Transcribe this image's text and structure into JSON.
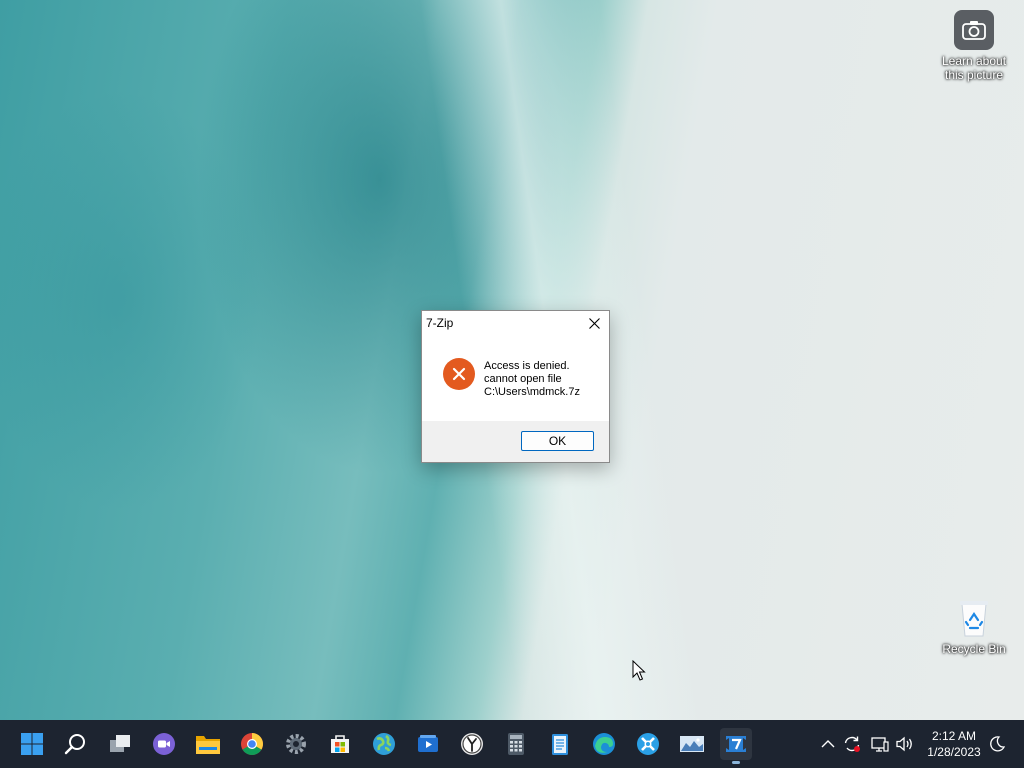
{
  "desktop": {
    "icons": [
      {
        "label": "Learn about this picture",
        "icon": "camera-icon"
      },
      {
        "label": "Recycle Bin",
        "icon": "recycle-bin-icon"
      }
    ]
  },
  "dialog": {
    "title": "7-Zip",
    "message_line1": "Access is denied.",
    "message_line2": "cannot open file",
    "message_line3": "C:\\Users\\mdmck.7z",
    "ok_label": "OK",
    "icon": "error-icon",
    "error_color": "#e35a1f"
  },
  "taskbar": {
    "apps": [
      {
        "name": "Start",
        "icon": "windows-start-icon"
      },
      {
        "name": "Search",
        "icon": "search-icon"
      },
      {
        "name": "Task View",
        "icon": "task-view-icon"
      },
      {
        "name": "Chat",
        "icon": "chat-camera-icon"
      },
      {
        "name": "File Explorer",
        "icon": "folder-icon"
      },
      {
        "name": "Chrome",
        "icon": "chrome-icon"
      },
      {
        "name": "Settings",
        "icon": "gear-icon"
      },
      {
        "name": "Microsoft Store",
        "icon": "store-icon"
      },
      {
        "name": "Maps",
        "icon": "globe-icon"
      },
      {
        "name": "Media Player",
        "icon": "media-icon"
      },
      {
        "name": "Clock",
        "icon": "clock-icon"
      },
      {
        "name": "Calculator",
        "icon": "calculator-icon"
      },
      {
        "name": "Notepad",
        "icon": "notepad-icon"
      },
      {
        "name": "Edge",
        "icon": "edge-icon"
      },
      {
        "name": "App",
        "icon": "compass-icon"
      },
      {
        "name": "Photos",
        "icon": "photos-icon"
      },
      {
        "name": "7-Zip",
        "icon": "7zip-icon"
      }
    ],
    "clock": {
      "time": "2:12 AM",
      "date": "1/28/2023"
    },
    "tray": [
      "chevron-up-icon",
      "sync-icon",
      "network-icon",
      "volume-icon",
      "moon-icon"
    ]
  }
}
